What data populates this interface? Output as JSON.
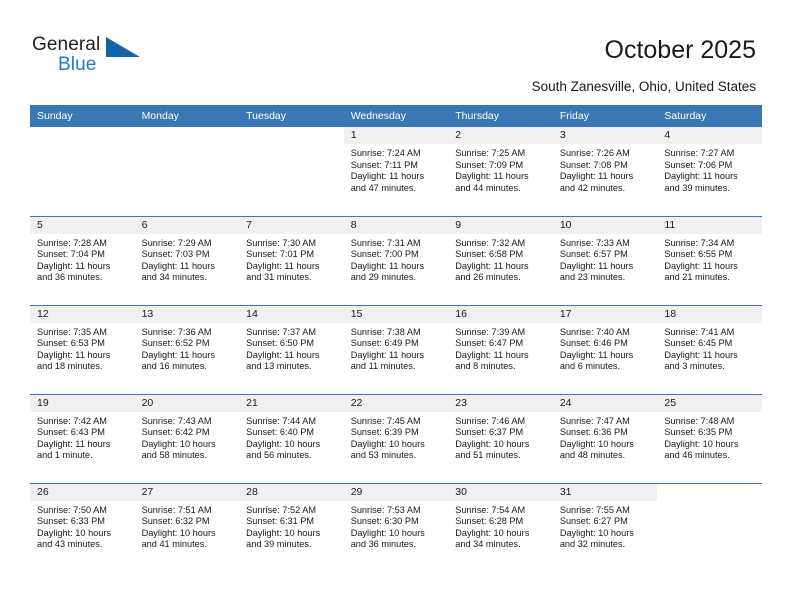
{
  "brand": {
    "name_part1": "General",
    "name_part2": "Blue",
    "triangle_icon": "blue-triangle-icon",
    "accent_color": "#1263a8"
  },
  "header": {
    "title": "October 2025",
    "subtitle": "South Zanesville, Ohio, United States"
  },
  "calendar": {
    "header_bg": "#3a78b5",
    "daynum_band_bg": "#f0f0f0",
    "weekday_headers": [
      "Sunday",
      "Monday",
      "Tuesday",
      "Wednesday",
      "Thursday",
      "Friday",
      "Saturday"
    ],
    "weeks": [
      [
        {
          "day": "",
          "lines": []
        },
        {
          "day": "",
          "lines": []
        },
        {
          "day": "",
          "lines": []
        },
        {
          "day": "1",
          "lines": [
            "Sunrise: 7:24 AM",
            "Sunset: 7:11 PM",
            "Daylight: 11 hours",
            "and 47 minutes."
          ]
        },
        {
          "day": "2",
          "lines": [
            "Sunrise: 7:25 AM",
            "Sunset: 7:09 PM",
            "Daylight: 11 hours",
            "and 44 minutes."
          ]
        },
        {
          "day": "3",
          "lines": [
            "Sunrise: 7:26 AM",
            "Sunset: 7:08 PM",
            "Daylight: 11 hours",
            "and 42 minutes."
          ]
        },
        {
          "day": "4",
          "lines": [
            "Sunrise: 7:27 AM",
            "Sunset: 7:06 PM",
            "Daylight: 11 hours",
            "and 39 minutes."
          ]
        }
      ],
      [
        {
          "day": "5",
          "lines": [
            "Sunrise: 7:28 AM",
            "Sunset: 7:04 PM",
            "Daylight: 11 hours",
            "and 36 minutes."
          ]
        },
        {
          "day": "6",
          "lines": [
            "Sunrise: 7:29 AM",
            "Sunset: 7:03 PM",
            "Daylight: 11 hours",
            "and 34 minutes."
          ]
        },
        {
          "day": "7",
          "lines": [
            "Sunrise: 7:30 AM",
            "Sunset: 7:01 PM",
            "Daylight: 11 hours",
            "and 31 minutes."
          ]
        },
        {
          "day": "8",
          "lines": [
            "Sunrise: 7:31 AM",
            "Sunset: 7:00 PM",
            "Daylight: 11 hours",
            "and 29 minutes."
          ]
        },
        {
          "day": "9",
          "lines": [
            "Sunrise: 7:32 AM",
            "Sunset: 6:58 PM",
            "Daylight: 11 hours",
            "and 26 minutes."
          ]
        },
        {
          "day": "10",
          "lines": [
            "Sunrise: 7:33 AM",
            "Sunset: 6:57 PM",
            "Daylight: 11 hours",
            "and 23 minutes."
          ]
        },
        {
          "day": "11",
          "lines": [
            "Sunrise: 7:34 AM",
            "Sunset: 6:55 PM",
            "Daylight: 11 hours",
            "and 21 minutes."
          ]
        }
      ],
      [
        {
          "day": "12",
          "lines": [
            "Sunrise: 7:35 AM",
            "Sunset: 6:53 PM",
            "Daylight: 11 hours",
            "and 18 minutes."
          ]
        },
        {
          "day": "13",
          "lines": [
            "Sunrise: 7:36 AM",
            "Sunset: 6:52 PM",
            "Daylight: 11 hours",
            "and 16 minutes."
          ]
        },
        {
          "day": "14",
          "lines": [
            "Sunrise: 7:37 AM",
            "Sunset: 6:50 PM",
            "Daylight: 11 hours",
            "and 13 minutes."
          ]
        },
        {
          "day": "15",
          "lines": [
            "Sunrise: 7:38 AM",
            "Sunset: 6:49 PM",
            "Daylight: 11 hours",
            "and 11 minutes."
          ]
        },
        {
          "day": "16",
          "lines": [
            "Sunrise: 7:39 AM",
            "Sunset: 6:47 PM",
            "Daylight: 11 hours",
            "and 8 minutes."
          ]
        },
        {
          "day": "17",
          "lines": [
            "Sunrise: 7:40 AM",
            "Sunset: 6:46 PM",
            "Daylight: 11 hours",
            "and 6 minutes."
          ]
        },
        {
          "day": "18",
          "lines": [
            "Sunrise: 7:41 AM",
            "Sunset: 6:45 PM",
            "Daylight: 11 hours",
            "and 3 minutes."
          ]
        }
      ],
      [
        {
          "day": "19",
          "lines": [
            "Sunrise: 7:42 AM",
            "Sunset: 6:43 PM",
            "Daylight: 11 hours",
            "and 1 minute."
          ]
        },
        {
          "day": "20",
          "lines": [
            "Sunrise: 7:43 AM",
            "Sunset: 6:42 PM",
            "Daylight: 10 hours",
            "and 58 minutes."
          ]
        },
        {
          "day": "21",
          "lines": [
            "Sunrise: 7:44 AM",
            "Sunset: 6:40 PM",
            "Daylight: 10 hours",
            "and 56 minutes."
          ]
        },
        {
          "day": "22",
          "lines": [
            "Sunrise: 7:45 AM",
            "Sunset: 6:39 PM",
            "Daylight: 10 hours",
            "and 53 minutes."
          ]
        },
        {
          "day": "23",
          "lines": [
            "Sunrise: 7:46 AM",
            "Sunset: 6:37 PM",
            "Daylight: 10 hours",
            "and 51 minutes."
          ]
        },
        {
          "day": "24",
          "lines": [
            "Sunrise: 7:47 AM",
            "Sunset: 6:36 PM",
            "Daylight: 10 hours",
            "and 48 minutes."
          ]
        },
        {
          "day": "25",
          "lines": [
            "Sunrise: 7:48 AM",
            "Sunset: 6:35 PM",
            "Daylight: 10 hours",
            "and 46 minutes."
          ]
        }
      ],
      [
        {
          "day": "26",
          "lines": [
            "Sunrise: 7:50 AM",
            "Sunset: 6:33 PM",
            "Daylight: 10 hours",
            "and 43 minutes."
          ]
        },
        {
          "day": "27",
          "lines": [
            "Sunrise: 7:51 AM",
            "Sunset: 6:32 PM",
            "Daylight: 10 hours",
            "and 41 minutes."
          ]
        },
        {
          "day": "28",
          "lines": [
            "Sunrise: 7:52 AM",
            "Sunset: 6:31 PM",
            "Daylight: 10 hours",
            "and 39 minutes."
          ]
        },
        {
          "day": "29",
          "lines": [
            "Sunrise: 7:53 AM",
            "Sunset: 6:30 PM",
            "Daylight: 10 hours",
            "and 36 minutes."
          ]
        },
        {
          "day": "30",
          "lines": [
            "Sunrise: 7:54 AM",
            "Sunset: 6:28 PM",
            "Daylight: 10 hours",
            "and 34 minutes."
          ]
        },
        {
          "day": "31",
          "lines": [
            "Sunrise: 7:55 AM",
            "Sunset: 6:27 PM",
            "Daylight: 10 hours",
            "and 32 minutes."
          ]
        },
        {
          "day": "",
          "lines": []
        }
      ]
    ]
  }
}
